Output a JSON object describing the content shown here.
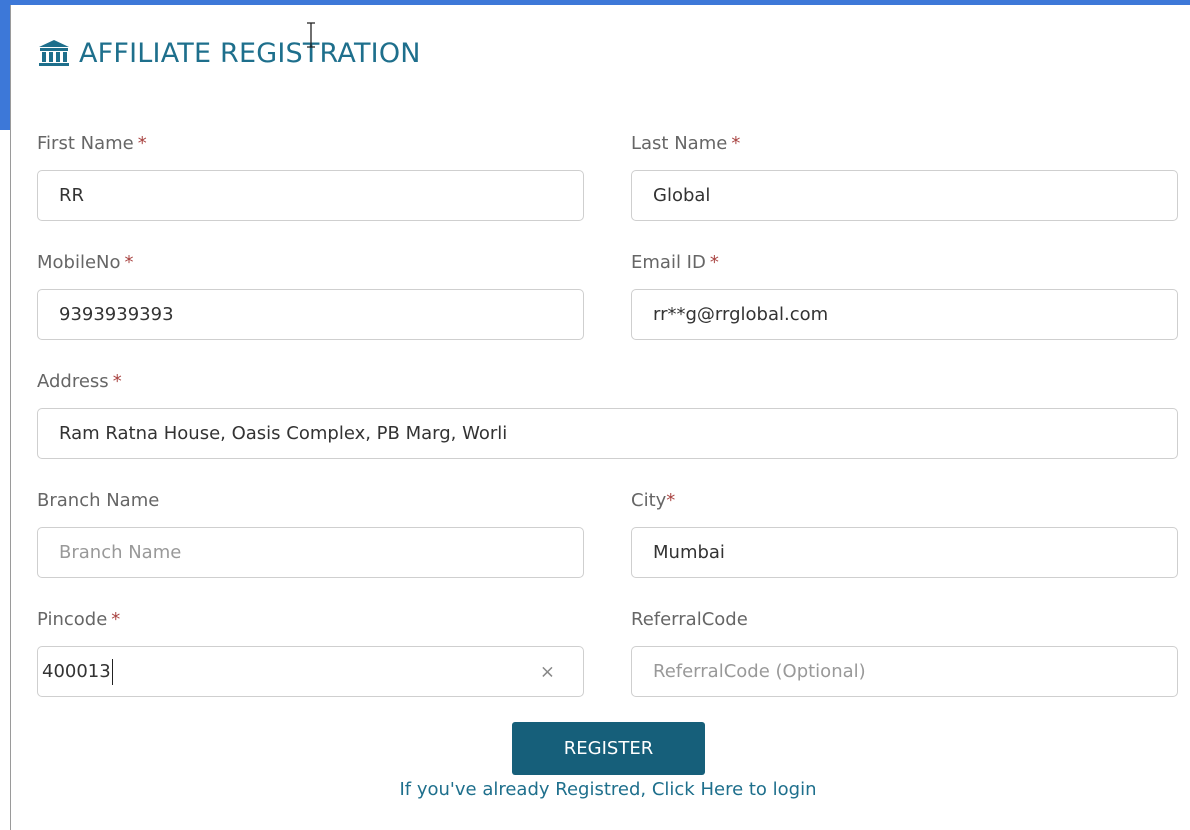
{
  "form": {
    "title": "AFFILIATE REGISTRATION",
    "title_icon": "bank-icon",
    "required_marker": "*",
    "fields": {
      "first_name": {
        "label": "First Name",
        "value": "RR",
        "placeholder": ""
      },
      "last_name": {
        "label": "Last Name",
        "value": "Global",
        "placeholder": ""
      },
      "mobile": {
        "label": "MobileNo",
        "value": "9393939393",
        "placeholder": ""
      },
      "email": {
        "label": "Email ID",
        "value": "rr**g@rrglobal.com",
        "placeholder": ""
      },
      "address": {
        "label": "Address",
        "value": "Ram Ratna House, Oasis Complex, PB Marg, Worli",
        "placeholder": ""
      },
      "branch": {
        "label": "Branch Name",
        "value": "",
        "placeholder": "Branch Name"
      },
      "city": {
        "label": "City",
        "value": "Mumbai",
        "placeholder": ""
      },
      "pincode": {
        "label": "Pincode",
        "value": "400013",
        "placeholder": "",
        "clear_icon": "×"
      },
      "referral": {
        "label": "ReferralCode",
        "value": "",
        "placeholder": "ReferralCode (Optional)"
      }
    },
    "register_label": "REGISTER",
    "login_text": "If you've already Registred, Click Here to login"
  },
  "colors": {
    "accent": "#1e6f8c",
    "button": "#165f7a",
    "required": "#a94442",
    "page_blue": "#3d78d8"
  }
}
